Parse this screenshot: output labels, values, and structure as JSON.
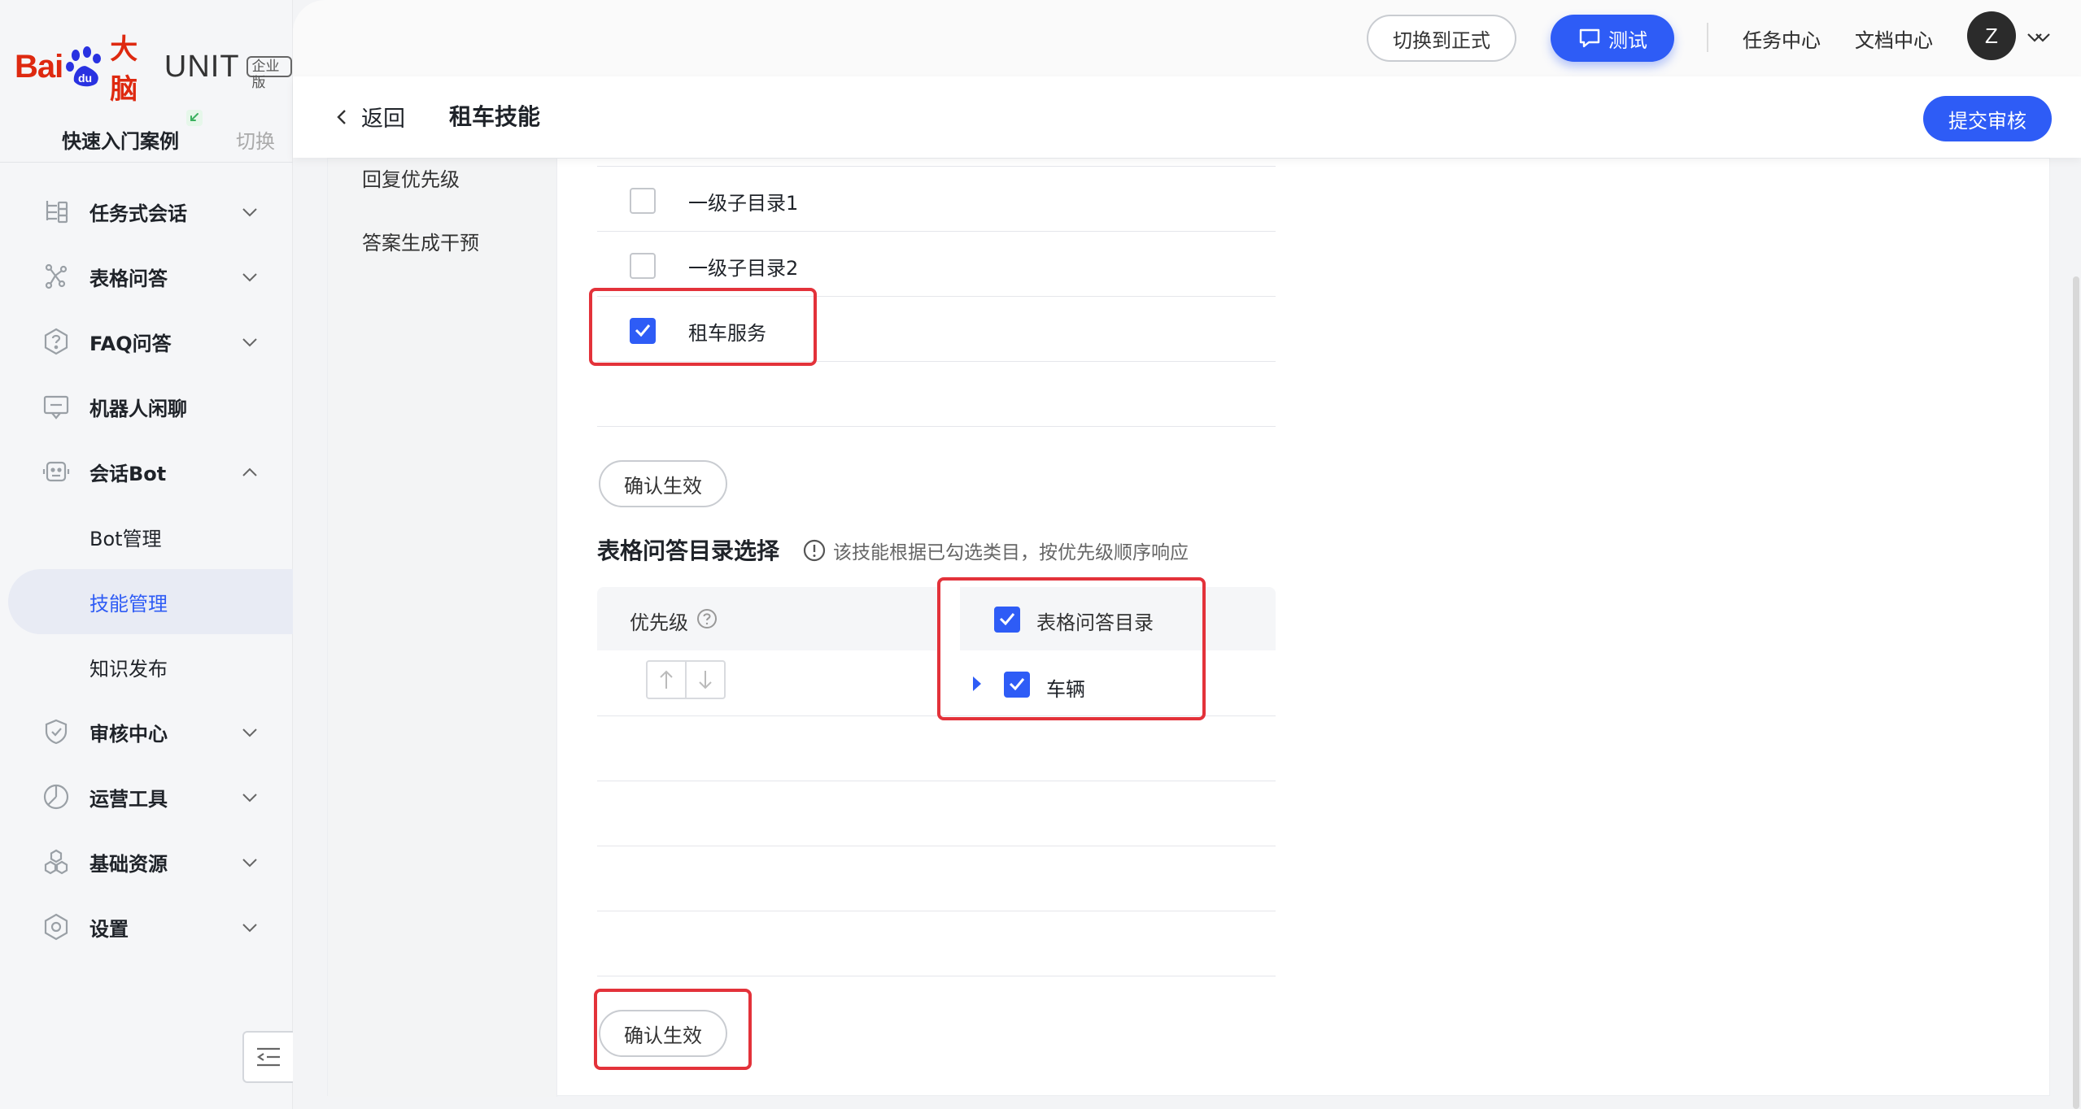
{
  "brand": {
    "bai": "Bai",
    "du": "du",
    "cn": "大脑",
    "unit": "UNIT",
    "badge": "企业版"
  },
  "case": {
    "name": "快速入门案例",
    "switch": "切换"
  },
  "nav": {
    "task": "任务式会话",
    "table_qa": "表格问答",
    "faq": "FAQ问答",
    "chitchat": "机器人闲聊",
    "bot": "会话Bot",
    "bot_manage": "Bot管理",
    "skill_manage": "技能管理",
    "knowledge_publish": "知识发布",
    "audit": "审核中心",
    "ops": "运营工具",
    "resources": "基础资源",
    "settings": "设置"
  },
  "topbar": {
    "switch_formal": "切换到正式",
    "test": "测试",
    "task_center": "任务中心",
    "doc_center": "文档中心",
    "avatar": "Z"
  },
  "subbar": {
    "back": "返回",
    "title": "租车技能",
    "submit": "提交审核"
  },
  "left_pane": {
    "item1": "回复优先级",
    "item2": "答案生成干预"
  },
  "faq_dirs": {
    "rows": [
      {
        "label": "一级子目录1",
        "checked": false
      },
      {
        "label": "一级子目录2",
        "checked": false
      },
      {
        "label": "租车服务",
        "checked": true
      }
    ],
    "confirm": "确认生效"
  },
  "table_qa": {
    "title": "表格问答目录选择",
    "hint": "该技能根据已勾选类目，按优先级顺序响应",
    "col_priority": "优先级",
    "col_dir": "表格问答目录",
    "row_label": "车辆",
    "confirm": "确认生效"
  }
}
